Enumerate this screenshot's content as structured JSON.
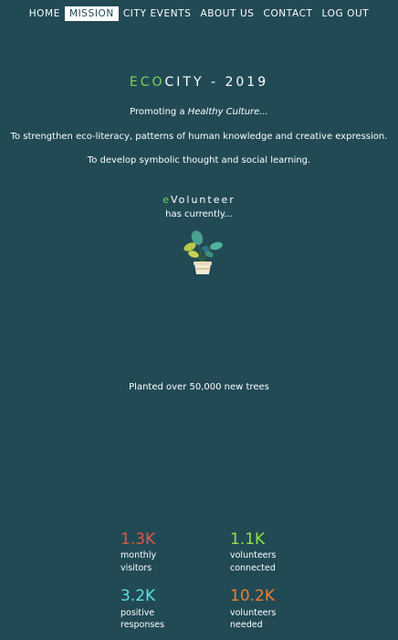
{
  "nav": {
    "items": [
      {
        "label": "HOME",
        "active": false
      },
      {
        "label": "MISSION",
        "active": true
      },
      {
        "label": "CITY EVENTS",
        "active": false
      },
      {
        "label": "ABOUT US",
        "active": false
      },
      {
        "label": "CONTACT",
        "active": false
      },
      {
        "label": "LOG OUT",
        "active": false
      }
    ]
  },
  "hero": {
    "title_accent": "ECO",
    "title_rest": "CITY - 2019",
    "promo_prefix": "Promoting a ",
    "promo_emph": "Healthy Culture...",
    "line1": "To strengthen eco-literacy, patterns of human knowledge and creative expression.",
    "line2": "To develop symbolic thought and social learning."
  },
  "volunteer": {
    "prefix": "e",
    "name": "Volunteer",
    "subtitle": "has currently...",
    "achievement": "Planted over 50,000 new trees"
  },
  "stats": [
    {
      "value": "1.3K",
      "label1": "monthly",
      "label2": "visitors",
      "color": "#e2573f"
    },
    {
      "value": "1.1K",
      "label1": "volunteers",
      "label2": "connected",
      "color": "#8ee04a"
    },
    {
      "value": "3.2K",
      "label1": "positive",
      "label2": "responses",
      "color": "#5fe0e0"
    },
    {
      "value": "10.2K",
      "label1": "volunteers",
      "label2": "needed",
      "color": "#f07f2e"
    }
  ],
  "colors": {
    "background": "#214a55",
    "accent_green": "#7fd35a",
    "text": "#ffffff"
  },
  "icons": {
    "plant": "potted-plant-icon"
  }
}
